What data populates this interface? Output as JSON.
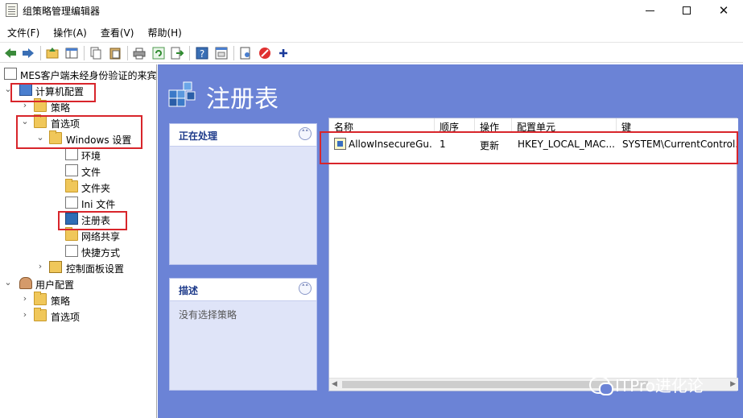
{
  "window": {
    "title": "组策略管理编辑器",
    "controls": {
      "minimize": "—",
      "maximize": "☐",
      "close": "✕"
    }
  },
  "menu": [
    {
      "label": "文件(F)"
    },
    {
      "label": "操作(A)"
    },
    {
      "label": "查看(V)"
    },
    {
      "label": "帮助(H)"
    }
  ],
  "toolbar_icons": [
    "back-arrow-icon",
    "forward-arrow-icon",
    "up-folder-icon",
    "show-hide-tree-icon",
    "copy-icon",
    "paste-icon",
    "print-icon",
    "refresh-icon",
    "export-list-icon",
    "help-icon",
    "properties-icon",
    "new-item-icon",
    "stop-icon",
    "add-icon"
  ],
  "tree": {
    "root": "MES客户端未经身份验证的来宾",
    "computer_config": "计算机配置",
    "policies": "策略",
    "preferences": "首选项",
    "windows_settings": "Windows 设置",
    "env": "环境",
    "files": "文件",
    "folders": "文件夹",
    "ini_files": "Ini 文件",
    "registry": "注册表",
    "network_shares": "网络共享",
    "shortcuts": "快捷方式",
    "control_panel": "控制面板设置",
    "user_config": "用户配置",
    "user_policies": "策略",
    "user_preferences": "首选项"
  },
  "main": {
    "title": "注册表",
    "processing_panel": {
      "title": "正在处理",
      "body": ""
    },
    "description_panel": {
      "title": "描述",
      "body": "没有选择策略"
    },
    "columns": [
      "名称",
      "顺序",
      "操作",
      "配置单元",
      "键"
    ],
    "rows": [
      {
        "name": "AllowInsecureGu...",
        "order": "1",
        "action": "更新",
        "hive": "HKEY_LOCAL_MAC...",
        "key": "SYSTEM\\CurrentControl..."
      }
    ]
  },
  "watermark": "ITPro进化论",
  "colors": {
    "right_pane": "#6b83d6",
    "highlight": "#d8252b",
    "panel_title": "#1d3a8a"
  }
}
